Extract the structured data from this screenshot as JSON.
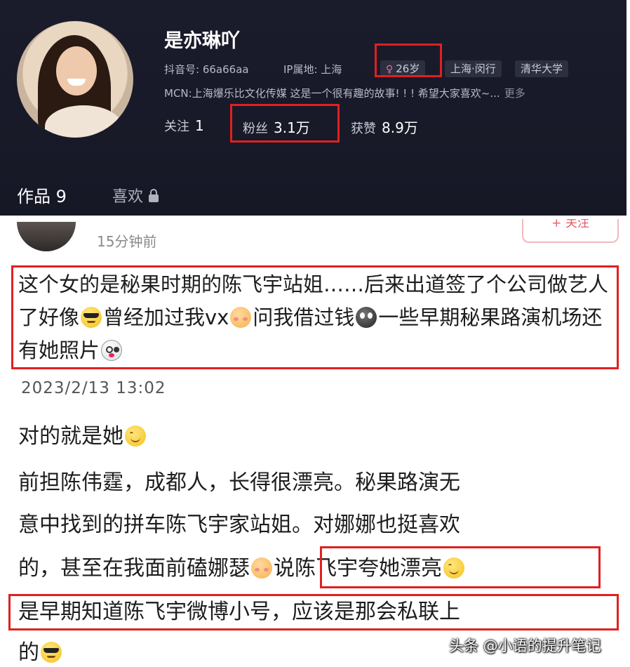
{
  "profile": {
    "name": "是亦琳吖",
    "douyin_id": "抖音号: 66a66aa",
    "ip_location": "IP属地: 上海",
    "age_tag": "26岁",
    "age_symbol": "♀",
    "district_tag": "上海·闵行",
    "school_tag": "清华大学",
    "bio": "MCN:上海爆乐比文化传媒 这是一个很有趣的故事! ! ! 希望大家喜欢~...",
    "bio_more": "更多",
    "following_label": "关注",
    "following_count": "1",
    "fans_label": "粉丝",
    "fans_count": "3.1万",
    "likes_label": "获赞",
    "likes_count": "8.9万",
    "tab_works": "作品 9",
    "tab_likes": "喜欢"
  },
  "comment": {
    "time": "15分钟前",
    "follow_label": "+ 关注",
    "seg1": "这个女的是秘果时期的陈飞宇站姐……后来出道签了个公司做艺人了好像",
    "seg2": "曾经加过我vx",
    "seg3": "问我借过钱",
    "seg4": "一些早期秘果路演机场还有她照片"
  },
  "post": {
    "date": "2023/2/13 13:02",
    "line1": "对的就是她",
    "line2": "前担陈伟霆，成都人，长得很漂亮。秘果路演无",
    "line3": "意中找到的拼车陈飞宇家站姐。对娜娜也挺喜欢",
    "line4a": "的，甚至在我面前磕娜瑟",
    "line4b": "说陈飞宇夸她漂亮",
    "line5": "是早期知道陈飞宇微博小号，应该是那会私联上",
    "line6": "的"
  },
  "watermark": "头条 @小语的提升笔记",
  "colors": {
    "profile_bg": "#1a1c2c",
    "highlight_box": "#e02020",
    "follow_accent": "#e25c67"
  }
}
